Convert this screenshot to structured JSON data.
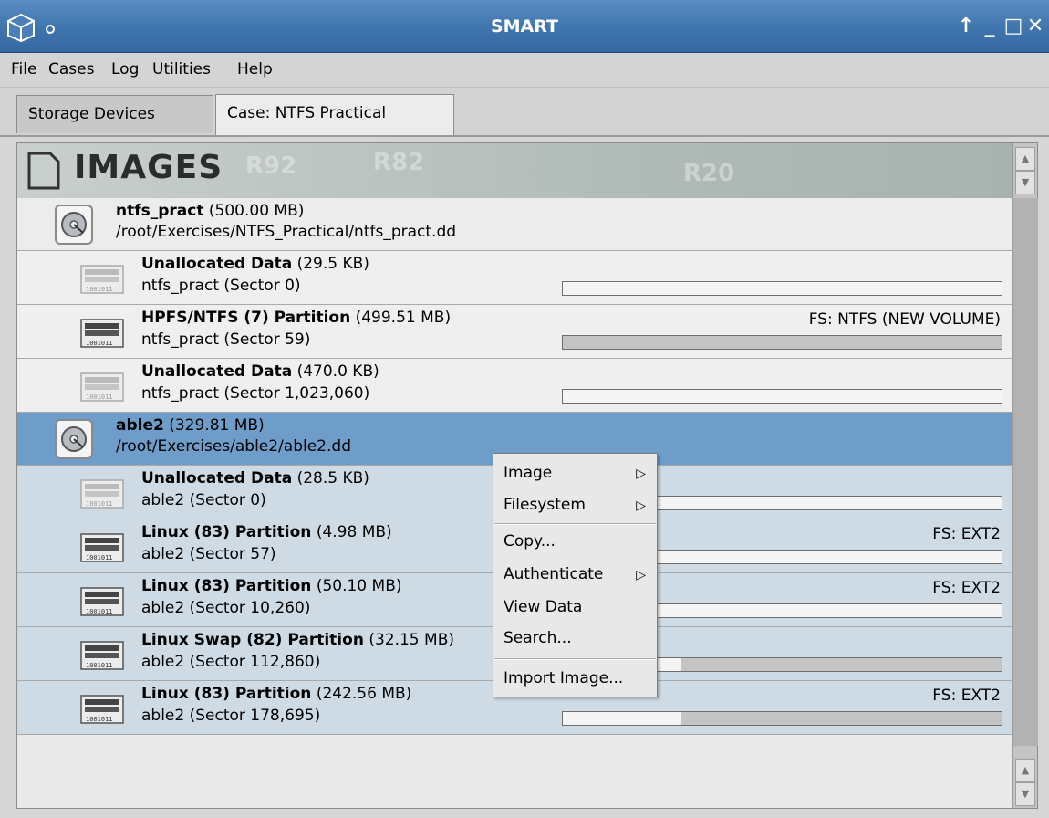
{
  "window": {
    "title": "SMART",
    "buttons": [
      "↑",
      "_",
      "□",
      "✕"
    ]
  },
  "menubar": [
    "File",
    "Cases",
    "Log",
    "Utilities",
    "Help"
  ],
  "tabs": [
    {
      "label": "Storage Devices",
      "active": false
    },
    {
      "label": "Case: NTFS Practical",
      "active": true
    }
  ],
  "panel": {
    "title": "IMAGES",
    "header_deco": [
      "R92",
      "R82",
      "R20"
    ]
  },
  "rows": [
    {
      "kind": "image",
      "name": "ntfs_pract",
      "size": "(500.00 MB)",
      "path": "/root/Exercises/NTFS_Practical/ntfs_pract.dd"
    },
    {
      "kind": "part",
      "name": "Unallocated Data",
      "size": "(29.5 KB)",
      "sub": "ntfs_pract (Sector 0)",
      "fs": "",
      "used": 0.0
    },
    {
      "kind": "part",
      "name": "HPFS/NTFS (7) Partition",
      "size": "(499.51 MB)",
      "sub": "ntfs_pract (Sector 59)",
      "fs": "FS: NTFS (NEW VOLUME)",
      "used": 1.0
    },
    {
      "kind": "part",
      "name": "Unallocated Data",
      "size": "(470.0 KB)",
      "sub": "ntfs_pract (Sector 1,023,060)",
      "fs": "",
      "used": 0.0
    },
    {
      "kind": "image",
      "name": "able2",
      "size": "(329.81 MB)",
      "path": "/root/Exercises/able2/able2.dd",
      "selected": true
    },
    {
      "kind": "part",
      "name": "Unallocated Data",
      "size": "(28.5 KB)",
      "sub": "able2 (Sector 0)",
      "fs": "",
      "used": 0.0
    },
    {
      "kind": "part",
      "name": "Linux (83) Partition",
      "size": "(4.98 MB)",
      "sub": "able2 (Sector 57)",
      "fs": "FS: EXT2",
      "used": 0.0
    },
    {
      "kind": "part",
      "name": "Linux (83) Partition",
      "size": "(50.10 MB)",
      "sub": "able2 (Sector 10,260)",
      "fs": "FS: EXT2",
      "used": 0.0
    },
    {
      "kind": "part",
      "name": "Linux Swap (82) Partition",
      "size": "(32.15 MB)",
      "sub": "able2 (Sector 112,860)",
      "fs": "",
      "used": 0.27
    },
    {
      "kind": "part",
      "name": "Linux (83) Partition",
      "size": "(242.56 MB)",
      "sub": "able2 (Sector 178,695)",
      "fs": "FS: EXT2",
      "used": 0.27
    }
  ],
  "context_menu": {
    "items": [
      {
        "label": "Image",
        "submenu": true
      },
      {
        "label": "Filesystem",
        "submenu": true
      },
      {
        "label": "Copy...",
        "submenu": false
      },
      {
        "label": "Authenticate",
        "submenu": true
      },
      {
        "label": "View Data",
        "submenu": false
      },
      {
        "label": "Search...",
        "submenu": false
      },
      {
        "label": "Import Image...",
        "submenu": false
      }
    ]
  },
  "colors": {
    "titlebar": "#3f74ad",
    "selection": "#6f9dc9",
    "highlight": "#cfdbe4"
  }
}
